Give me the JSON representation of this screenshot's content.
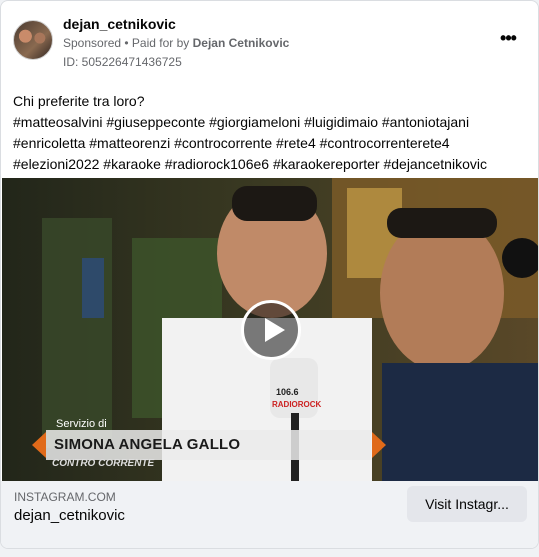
{
  "header": {
    "page_name": "dejan_cetnikovic",
    "sponsored": "Sponsored",
    "separator": " • ",
    "paid_for_prefix": "Paid for by ",
    "paid_for_name": "Dejan Cetnikovic",
    "ad_id": "ID: 505226471436725",
    "more_icon": "•••"
  },
  "post": {
    "line1": "Chi preferite tra loro?",
    "line2": "#matteosalvini #giuseppeconte #giorgiameloni #luigidimaio #antoniotajani",
    "line3": "#enricoletta #matteorenzi #controcorrente #rete4 #controcorrenterete4",
    "line4": "#elezioni2022 #karaoke #radiorock106e6 #karaokereporter #dejancetnikovic"
  },
  "video": {
    "overlay_small": "Servizio di",
    "overlay_name": "SIMONA ANGELA GALLO",
    "overlay_logo": "CONTRO CORRENTE",
    "mic_label_top": "106.6",
    "mic_label_brand": "RADIOROCK",
    "accent_color": "#e06a1a"
  },
  "footer": {
    "domain": "INSTAGRAM.COM",
    "title": "dejan_cetnikovic",
    "cta_label": "Visit Instagr..."
  }
}
